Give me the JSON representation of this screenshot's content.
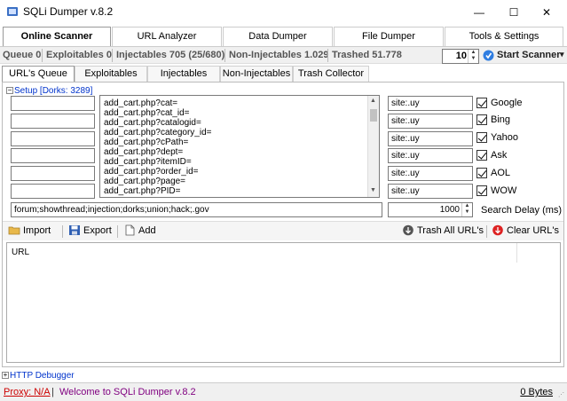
{
  "window": {
    "title": "SQLi Dumper v.8.2",
    "minimize": "—",
    "maximize": "☐",
    "close": "✕"
  },
  "main_tabs": [
    "Online Scanner",
    "URL Analyzer",
    "Data Dumper",
    "File Dumper",
    "Tools & Settings"
  ],
  "stats": {
    "queue": "Queue 0",
    "exploitables": "Exploitables 0",
    "injectables": "Injectables 705 (25/680)",
    "non_injectables": "Non-Injectables 1.029",
    "trashed": "Trashed 51.778"
  },
  "threads": {
    "value": "10"
  },
  "start_scanner": {
    "label": "Start Scanner",
    "arrow": "▾"
  },
  "sub_tabs": [
    "URL's Queue",
    "Exploitables",
    "Injectables",
    "Non-Injectables",
    "Trash Collector"
  ],
  "setup": {
    "toggle": "−",
    "label": "Setup [Dorks: 3289]"
  },
  "dorks": [
    "add_cart.php?cat=",
    "add_cart.php?cat_id=",
    "add_cart.php?catalogid=",
    "add_cart.php?category_id=",
    "add_cart.php?cPath=",
    "add_cart.php?dept=",
    "add_cart.php?itemID=",
    "add_cart.php?order_id=",
    "add_cart.php?page=",
    "add_cart.php?PID="
  ],
  "site_filters": [
    "site:.uy",
    "site:.uy",
    "site:.uy",
    "site:.uy",
    "site:.uy",
    "site:.uy"
  ],
  "engines": [
    {
      "name": "Google",
      "checked": true
    },
    {
      "name": "Bing",
      "checked": true
    },
    {
      "name": "Yahoo",
      "checked": true
    },
    {
      "name": "Ask",
      "checked": true
    },
    {
      "name": "AOL",
      "checked": true
    },
    {
      "name": "WOW",
      "checked": true
    }
  ],
  "exclude_words": "forum;showthread;injection;dorks;union;hack;.gov",
  "search_delay": {
    "value": "1000",
    "label": "Search Delay (ms)"
  },
  "toolbar": {
    "import": "Import",
    "export": "Export",
    "add": "Add",
    "trash_all": "Trash All URL's",
    "clear": "Clear URL's"
  },
  "url_list": {
    "header": "URL"
  },
  "http_debugger": {
    "toggle": "+",
    "label": "HTTP Debugger"
  },
  "footer": {
    "proxy": "Proxy: N/A",
    "pipe": "|",
    "welcome": "Welcome to SQLi Dumper v.8.2",
    "bytes": "0 Bytes"
  },
  "colors": {
    "link_blue": "#0033cc",
    "proxy_red": "#cc0000",
    "welcome_purple": "#800080"
  }
}
